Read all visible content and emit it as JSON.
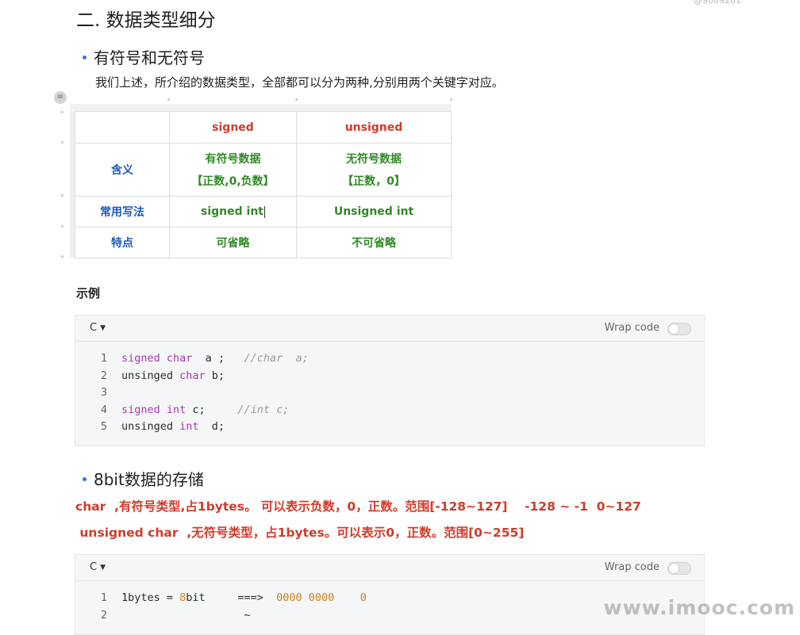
{
  "corner_id": "@9069281",
  "section": {
    "title": "二. 数据类型细分"
  },
  "sub1": {
    "title": "有符号和无符号",
    "paragraph": "我们上述，所介绍的数据类型，全部都可以分为两种,分别用两个关键字对应。"
  },
  "table": {
    "header": [
      "",
      "signed",
      "unsigned"
    ],
    "rows": [
      {
        "label": "含义",
        "signed": [
          "有符号数据",
          "【正数,0,负数】"
        ],
        "unsigned": [
          "无符号数据",
          "【正数，0】"
        ]
      },
      {
        "label": "常用写法",
        "signed": "signed int",
        "unsigned": "Unsigned int"
      },
      {
        "label": "特点",
        "signed": "可省略",
        "unsigned": "不可省略"
      }
    ]
  },
  "example_title": "示例",
  "code1": {
    "lang": "C",
    "wrap_label": "Wrap code",
    "lines": [
      {
        "n": "1",
        "parts": [
          {
            "t": "signed char",
            "c": "kw"
          },
          {
            "t": "  a ;   ",
            "c": "tx"
          },
          {
            "t": "//char  a;",
            "c": "cm"
          }
        ]
      },
      {
        "n": "2",
        "parts": [
          {
            "t": "unsinged ",
            "c": "tx"
          },
          {
            "t": "char",
            "c": "kw"
          },
          {
            "t": " b;",
            "c": "tx"
          }
        ]
      },
      {
        "n": "3",
        "parts": []
      },
      {
        "n": "4",
        "parts": [
          {
            "t": "signed int",
            "c": "kw"
          },
          {
            "t": " c;     ",
            "c": "tx"
          },
          {
            "t": "//int c;",
            "c": "cm"
          }
        ]
      },
      {
        "n": "5",
        "parts": [
          {
            "t": "unsinged ",
            "c": "tx"
          },
          {
            "t": "int",
            "c": "kw"
          },
          {
            "t": "  d;",
            "c": "tx"
          }
        ]
      }
    ]
  },
  "sub2": {
    "title": "8bit数据的存储"
  },
  "red_lines": [
    "char  ,有符号类型,占1bytes。 可以表示负数，0，正数。范围[-128~127]    -128 ~ -1  0~127",
    " unsigned char  ,无符号类型，占1bytes。可以表示0，正数。范围[0~255]"
  ],
  "code2": {
    "lang": "C",
    "wrap_label": "Wrap code",
    "lines": [
      {
        "n": "1",
        "parts": [
          {
            "t": "1bytes = ",
            "c": "tx"
          },
          {
            "t": "8",
            "c": "nm"
          },
          {
            "t": "bit     ===>  ",
            "c": "tx"
          },
          {
            "t": "0000 0000",
            "c": "nm"
          },
          {
            "t": "    ",
            "c": "tx"
          },
          {
            "t": "0",
            "c": "nm"
          }
        ]
      },
      {
        "n": "2",
        "parts": [
          {
            "t": "                   ~",
            "c": "tx"
          }
        ]
      }
    ]
  },
  "watermark": "www.imooc.com"
}
